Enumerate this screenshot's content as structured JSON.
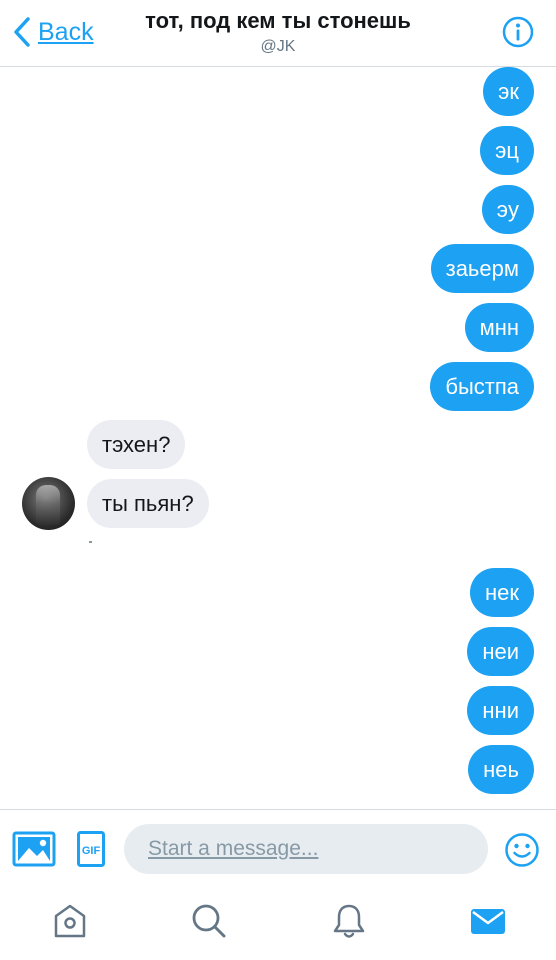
{
  "header": {
    "back_label": "Back",
    "title": "тот, под кем ты стонешь",
    "subtitle": "@JK"
  },
  "messages": [
    {
      "text": "эк",
      "direction": "outgoing"
    },
    {
      "text": "эц",
      "direction": "outgoing"
    },
    {
      "text": "эу",
      "direction": "outgoing"
    },
    {
      "text": "заьерм",
      "direction": "outgoing"
    },
    {
      "text": "мнн",
      "direction": "outgoing"
    },
    {
      "text": "быстпа",
      "direction": "outgoing"
    },
    {
      "text": "тэхен?",
      "direction": "incoming"
    },
    {
      "text": "ты пьян?",
      "direction": "incoming"
    },
    {
      "text": "нек",
      "direction": "outgoing"
    },
    {
      "text": "неи",
      "direction": "outgoing"
    },
    {
      "text": "нни",
      "direction": "outgoing"
    },
    {
      "text": "неь",
      "direction": "outgoing"
    }
  ],
  "composer": {
    "placeholder": "Start a message...",
    "gif_label": "GIF"
  },
  "tabs": [
    {
      "name": "home",
      "icon": "home-icon",
      "active": false
    },
    {
      "name": "search",
      "icon": "search-icon",
      "active": false
    },
    {
      "name": "notifications",
      "icon": "bell-icon",
      "active": false
    },
    {
      "name": "messages",
      "icon": "mail-icon",
      "active": true
    }
  ],
  "colors": {
    "accent": "#1da1f2",
    "incoming_bubble": "#ecedf2",
    "inactive_icon": "#657786",
    "input_background": "#e6ecf0"
  }
}
